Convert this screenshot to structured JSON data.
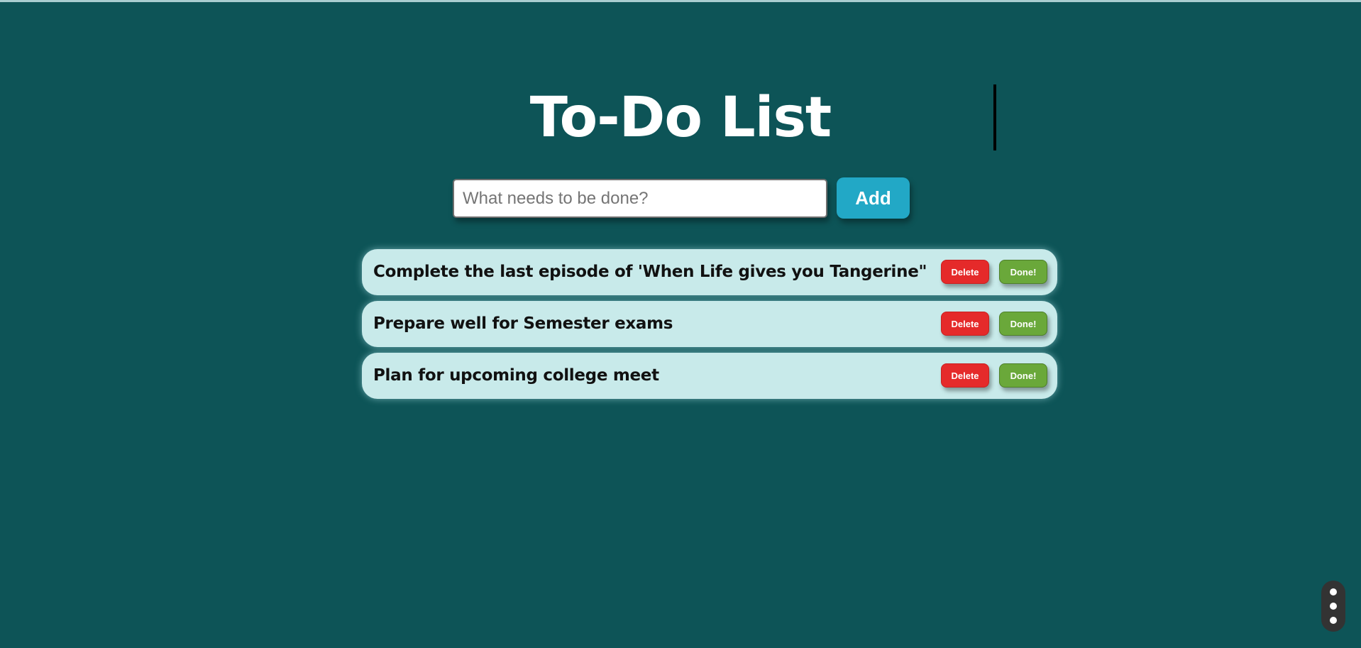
{
  "page": {
    "title": "To-Do List",
    "background_color": "#0d5457"
  },
  "input": {
    "value": "",
    "placeholder": "What needs to be done?"
  },
  "add_button": {
    "label": "Add",
    "color": "#22a8c6"
  },
  "todos": [
    {
      "text": "Complete the last episode of 'When Life gives you Tangerine\"",
      "delete_label": "Delete",
      "done_label": "Done!"
    },
    {
      "text": "Prepare well for Semester exams",
      "delete_label": "Delete",
      "done_label": "Done!"
    },
    {
      "text": "Plan for upcoming college meet",
      "delete_label": "Delete",
      "done_label": "Done!"
    }
  ],
  "colors": {
    "item_background": "#c8eaea",
    "delete": "#e52a2a",
    "done": "#6aa83a"
  },
  "floating_menu": {
    "icon": "more-vertical-icon"
  }
}
